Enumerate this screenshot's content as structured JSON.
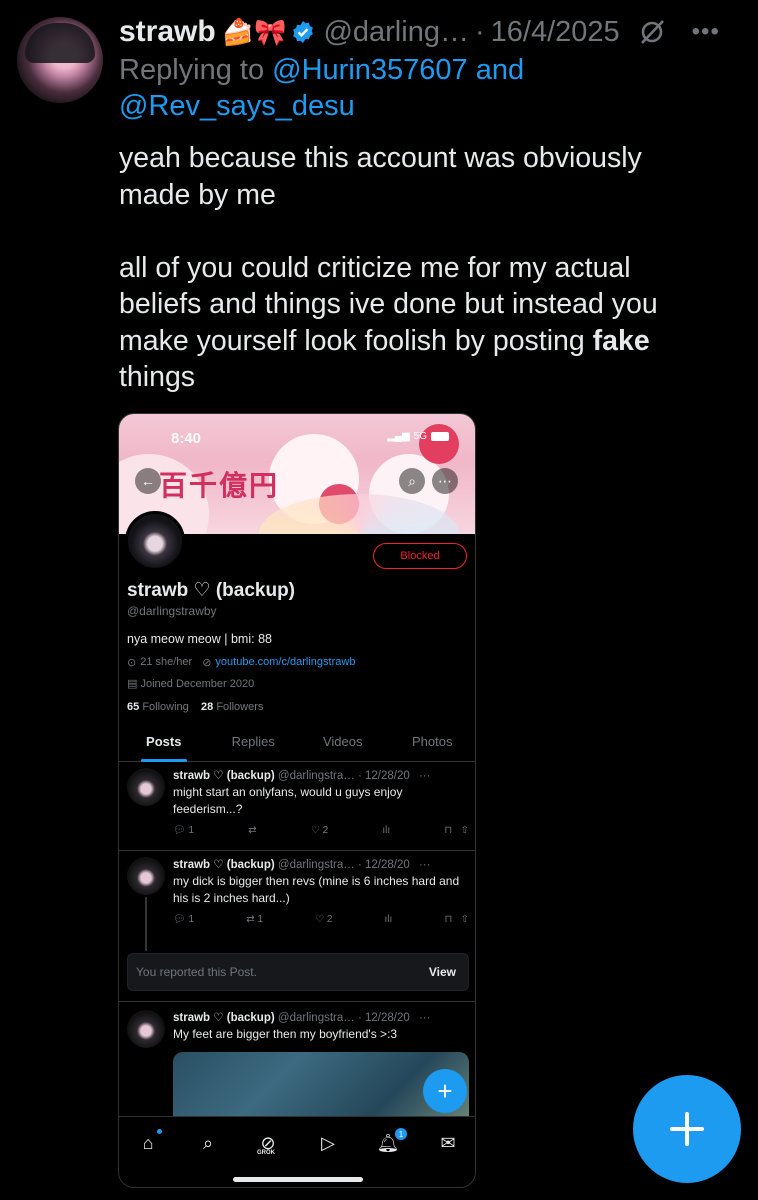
{
  "tweet": {
    "display_name": "strawb",
    "emojis": "🍰🎀",
    "handle": "@darling…",
    "separator": "·",
    "date": "16/4/2025",
    "more": "•••",
    "reply_prefix": "Replying to",
    "reply_mention_1": "@Hurin357607",
    "reply_and": "and",
    "reply_mention_2": "@Rev_says_desu",
    "text_line1": "yeah because this account was obviously made by me",
    "text_line2_a": "all of you could criticize me for my actual beliefs and things ive done but instead you make yourself look foolish by posting ",
    "text_line2_bold": "fake",
    "text_line2_b": " things"
  },
  "screenshot": {
    "status_time": "8:40",
    "status_signal": "5G",
    "banner_text": "百千億円",
    "blocked_label": "Blocked",
    "profile_name": "strawb ♡ (backup)",
    "profile_handle": "@darlingstrawby",
    "bio": "nya meow meow | bmi: 88",
    "meta_location": "21 she/her",
    "meta_link": "youtube.com/c/darlingstrawb",
    "joined": "Joined December 2020",
    "following_count": "65",
    "following_label": "Following",
    "followers_count": "28",
    "followers_label": "Followers",
    "tabs": [
      "Posts",
      "Replies",
      "Videos",
      "Photos"
    ],
    "posts": [
      {
        "name": "strawb ♡ (backup)",
        "meta": "@darlingstra… · 12/28/20",
        "text": "might start an onlyfans, would u guys enjoy feederism...?",
        "replies": "1",
        "reposts": "",
        "likes": "2"
      },
      {
        "name": "strawb ♡ (backup)",
        "meta": "@darlingstra… · 12/28/20",
        "text": "my dick is bigger then revs (mine is 6 inches hard and his is 2 inches hard...)",
        "replies": "1",
        "reposts": "1",
        "likes": "2"
      },
      {
        "name": "strawb ♡ (backup)",
        "meta": "@darlingstra… · 12/28/20",
        "text": "My feet are bigger then my boyfriend's >:3"
      }
    ],
    "reported_text": "You reported this Post.",
    "reported_view": "View",
    "nav_grok_label": "GROK",
    "notif_count": "1"
  },
  "colors": {
    "accent": "#1d9bf0",
    "muted": "#71767b",
    "text": "#e7e9ea",
    "blocked": "#f4212e",
    "background": "#000000"
  }
}
